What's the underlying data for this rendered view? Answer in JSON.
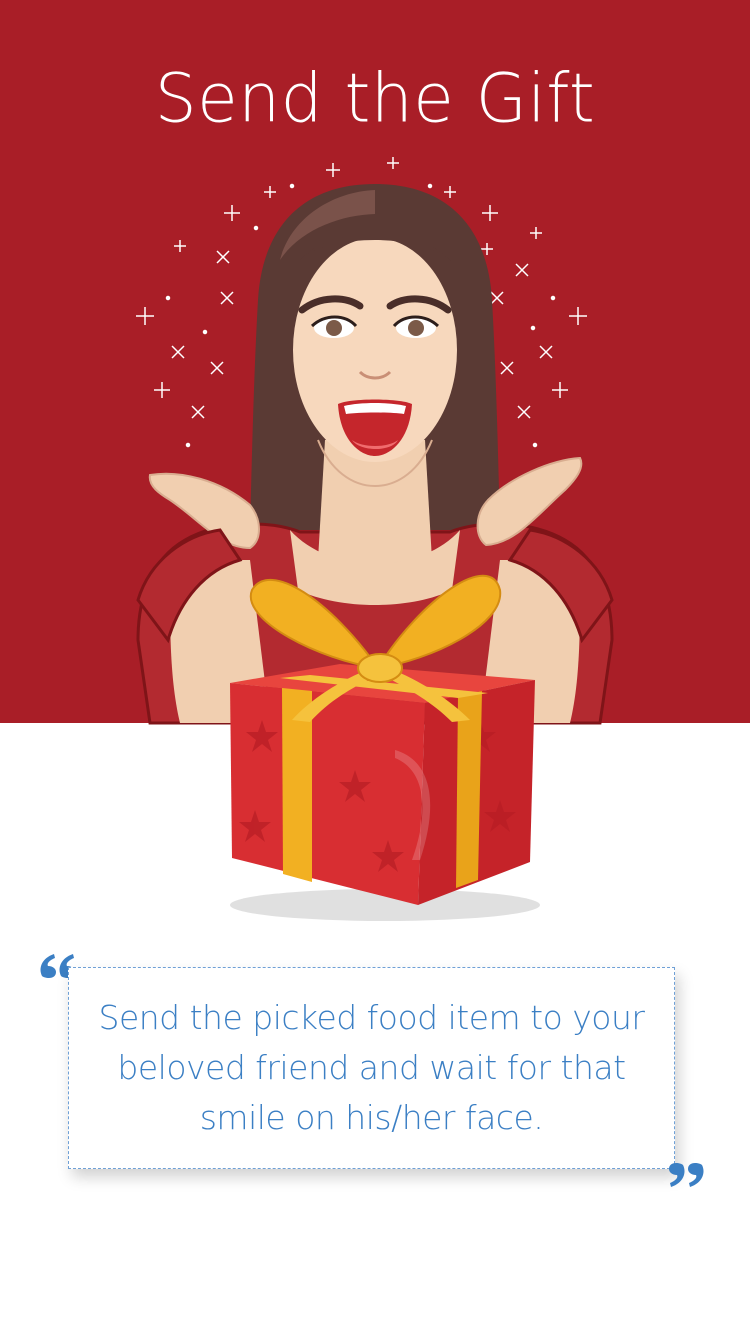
{
  "page": {
    "title": "Send the Gift",
    "description": "Send the picked food item to your beloved friend and wait for that smile on his/her face."
  },
  "colors": {
    "hero_background": "#a91e27",
    "accent_text": "#3b7fc4",
    "gift_red": "#d82e32",
    "ribbon_gold": "#f2b022"
  },
  "icons": {
    "open_quote": "open-quote-icon",
    "close_quote": "close-quote-icon"
  }
}
